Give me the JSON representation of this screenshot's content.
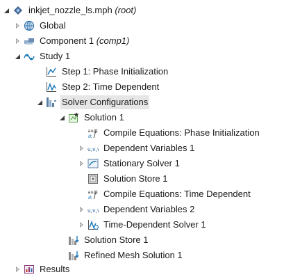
{
  "tree": {
    "root": {
      "label": "inkjet_nozzle_ls.mph",
      "suffix": "(root)"
    },
    "global": {
      "label": "Global"
    },
    "component": {
      "label": "Component 1",
      "suffix": "(comp1)"
    },
    "study": {
      "label": "Study 1"
    },
    "step1": {
      "label": "Step 1: Phase Initialization"
    },
    "step2": {
      "label": "Step 2: Time Dependent"
    },
    "solver_configs": {
      "label": "Solver Configurations"
    },
    "solution1": {
      "label": "Solution 1"
    },
    "compile1": {
      "label": "Compile Equations: Phase Initialization"
    },
    "depvars1": {
      "label": "Dependent Variables 1"
    },
    "stationary": {
      "label": "Stationary Solver 1"
    },
    "store_inner": {
      "label": "Solution Store 1"
    },
    "compile2": {
      "label": "Compile Equations: Time Dependent"
    },
    "depvars2": {
      "label": "Dependent Variables 2"
    },
    "timedep": {
      "label": "Time-Dependent Solver 1"
    },
    "store_outer": {
      "label": "Solution Store 1"
    },
    "refined": {
      "label": "Refined Mesh Solution 1"
    },
    "results": {
      "label": "Results"
    }
  },
  "icon_text": {
    "compile": "au∂t",
    "depvars": "u,v,w"
  }
}
